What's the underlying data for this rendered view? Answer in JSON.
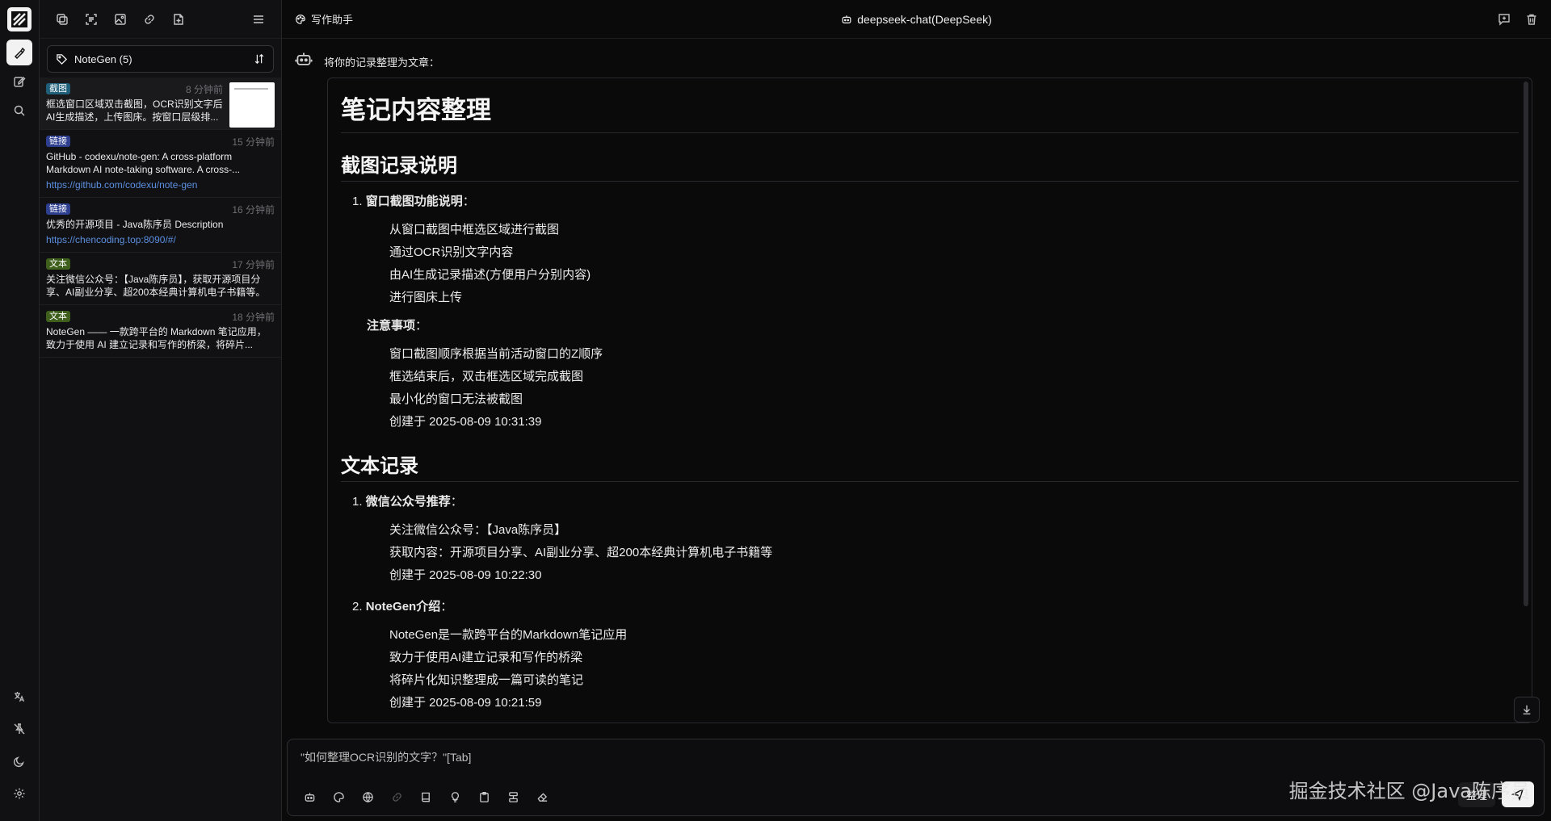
{
  "sidebar_rail": {
    "logo": "notegen-logo",
    "top_items": [
      {
        "icon": "pen-nib-icon",
        "active": true
      },
      {
        "icon": "edit-square-icon",
        "active": false
      },
      {
        "icon": "search-icon",
        "active": false
      }
    ],
    "bottom_items": [
      {
        "icon": "translate-icon"
      },
      {
        "icon": "pin-off-icon"
      },
      {
        "icon": "moon-icon"
      },
      {
        "icon": "gear-icon"
      }
    ]
  },
  "panel": {
    "toolbar_icons": [
      "copy-icon",
      "scan-icon",
      "image-plus-icon",
      "link-icon",
      "file-plus-icon",
      "menu-icon"
    ],
    "tag": {
      "label": "NoteGen (5)",
      "icon": "tag-icon",
      "sort_icon": "sort-arrows-icon"
    },
    "notes": [
      {
        "type": "截图",
        "kind": "shot",
        "time": "8 分钟前",
        "body": "框选窗口区域双击截图，OCR识别文字后AI生成描述，上传图床。按窗口层级排...",
        "link": "",
        "has_thumb": true
      },
      {
        "type": "链接",
        "kind": "link",
        "time": "15 分钟前",
        "body": "GitHub - codexu/note-gen: A cross-platform Markdown AI note-taking software. A cross-...",
        "link": "https://github.com/codexu/note-gen",
        "has_thumb": false
      },
      {
        "type": "链接",
        "kind": "link",
        "time": "16 分钟前",
        "body": "优秀的开源项目 - Java陈序员 Description",
        "link": "https://chencoding.top:8090/#/",
        "has_thumb": false
      },
      {
        "type": "文本",
        "kind": "text",
        "time": "17 分钟前",
        "body": "关注微信公众号：【Java陈序员】，获取开源项目分享、AI副业分享、超200本经典计算机电子书籍等。",
        "link": "",
        "has_thumb": false
      },
      {
        "type": "文本",
        "kind": "text",
        "time": "18 分钟前",
        "body": "NoteGen —— 一款跨平台的 Markdown 笔记应用，致力于使用 AI 建立记录和写作的桥梁，将碎片...",
        "link": "",
        "has_thumb": false
      }
    ]
  },
  "header": {
    "writer_label": "写作助手",
    "model_label": "deepseek-chat(DeepSeek)"
  },
  "chat": {
    "prompt": "将你的记录整理为文章：",
    "article": {
      "h1": "笔记内容整理",
      "sec1": {
        "h2": "截图记录说明",
        "item1_title": "窗口截图功能说明",
        "item1_num": "1.",
        "item1_lines": [
          "从窗口截图中框选区域进行截图",
          "通过OCR识别文字内容",
          "由AI生成记录描述(方便用户分别内容)",
          "进行图床上传"
        ],
        "notice_title": "注意事项",
        "notice_lines": [
          "窗口截图顺序根据当前活动窗口的Z顺序",
          "框选结束后，双击框选区域完成截图",
          "最小化的窗口无法被截图",
          "创建于 2025-08-09 10:31:39"
        ]
      },
      "sec2": {
        "h2": "文本记录",
        "item1_num": "1.",
        "item1_title": "微信公众号推荐",
        "item1_lines": [
          "关注微信公众号：【Java陈序员】",
          "获取内容：开源项目分享、AI副业分享、超200本经典计算机电子书籍等",
          "创建于 2025-08-09 10:22:30"
        ],
        "item2_num": "2.",
        "item2_title": "NoteGen介绍",
        "item2_lines": [
          "NoteGen是一款跨平台的Markdown笔记应用",
          "致力于使用AI建立记录和写作的桥梁",
          "将碎片化知识整理成一篇可读的笔记",
          "创建于 2025-08-09 10:21:59"
        ]
      }
    }
  },
  "input": {
    "placeholder": "\"如何整理OCR识别的文字？\"[Tab]",
    "organize_label": "整理",
    "tools": [
      "bot-icon",
      "palette-icon",
      "globe-icon",
      "link-icon",
      "book-icon",
      "lightbulb-icon",
      "clipboard-icon",
      "stack-icon",
      "eraser-icon"
    ]
  },
  "watermark": "掘金技术社区 @Java陈序员"
}
